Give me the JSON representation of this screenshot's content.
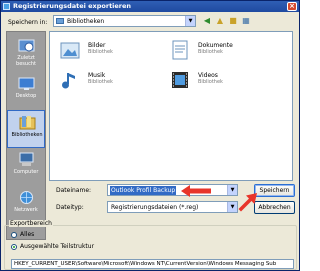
{
  "window": {
    "title": "Registrierungsdatei exportieren"
  },
  "lookin": {
    "label": "Speichern in:",
    "value": "Bibliotheken"
  },
  "toolbar": {
    "icons": [
      "back-icon",
      "up-folder-icon",
      "new-folder-icon",
      "views-icon"
    ]
  },
  "places": [
    {
      "label": "Zuletzt besucht",
      "icon": "recent-icon"
    },
    {
      "label": "Desktop",
      "icon": "desktop-icon"
    },
    {
      "label": "Bibliotheken",
      "icon": "libraries-icon",
      "active": true
    },
    {
      "label": "Computer",
      "icon": "computer-icon"
    },
    {
      "label": "Netzwerk",
      "icon": "network-icon"
    }
  ],
  "files": [
    {
      "name": "Bilder",
      "sub": "Bibliothek",
      "icon": "pictures-library-icon"
    },
    {
      "name": "Dokumente",
      "sub": "Bibliothek",
      "icon": "documents-library-icon"
    },
    {
      "name": "Musik",
      "sub": "Bibliothek",
      "icon": "music-library-icon"
    },
    {
      "name": "Videos",
      "sub": "Bibliothek",
      "icon": "videos-library-icon"
    }
  ],
  "filename": {
    "label": "Dateiname:",
    "value": "Outlook Profil Backup"
  },
  "filetype": {
    "label": "Dateityp:",
    "value": "Registrierungsdateien (*.reg)"
  },
  "buttons": {
    "save": "Speichern",
    "cancel": "Abbrechen"
  },
  "export_range": {
    "label": "Exportbereich",
    "option_all": "Alles",
    "option_branch": "Ausgewählte Teilstruktur",
    "selected": "branch",
    "branch_path": "HKEY_CURRENT_USER\\Software\\Microsoft\\Windows NT\\CurrentVersion\\Windows Messaging Sub"
  },
  "colors": {
    "arrow": "#e8352a",
    "selection": "#316ac5",
    "titlebar": "#1f4aa0"
  }
}
